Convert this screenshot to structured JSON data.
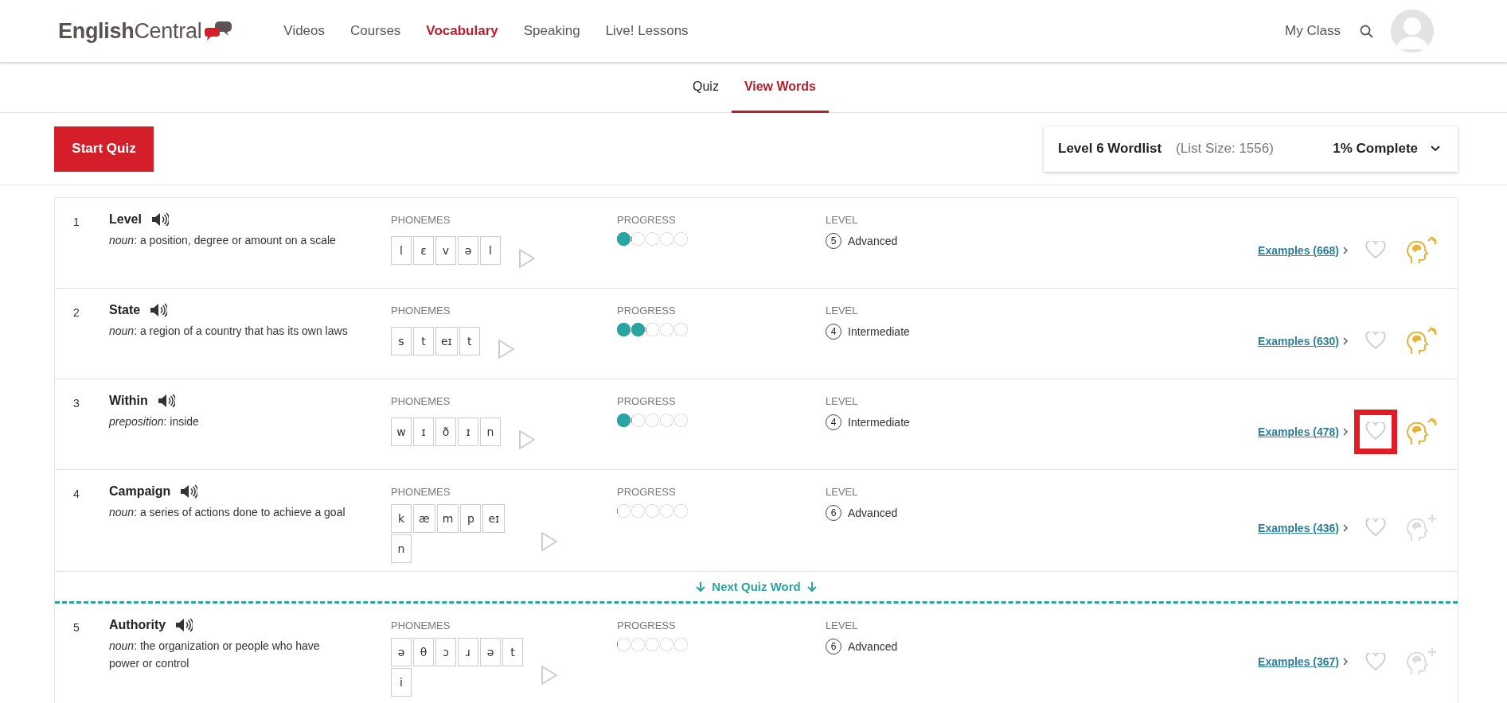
{
  "header": {
    "logo": "**English**Central",
    "nav": [
      {
        "label": "Videos",
        "selected": false
      },
      {
        "label": "Courses",
        "selected": false
      },
      {
        "label": "Vocabulary",
        "selected": true
      },
      {
        "label": "Speaking",
        "selected": false
      },
      {
        "label": "Live! Lessons",
        "selected": false
      }
    ],
    "my_class": "My Class"
  },
  "subtabs": [
    {
      "label": "Quiz",
      "selected": false
    },
    {
      "label": "View Words",
      "selected": true
    }
  ],
  "start_quiz": "Start Quiz",
  "wordlist": {
    "title": "Level 6 Wordlist",
    "size": "(List Size: 1556)",
    "complete": "1% Complete"
  },
  "list": [
    {
      "kind": "word",
      "number": "1",
      "word": "Level",
      "definition": "*noun*: a position, degree or amount on a scale",
      "phonemes_label": "PHONEMES",
      "phonemes": [
        "l",
        "ɛ",
        "v",
        "ə",
        "l"
      ],
      "progress_label": "PROGRESS",
      "level": 0.2,
      "level_label": "LEVEL",
      "level_number": "5",
      "level_name": "Advanced",
      "examples": "Examples (668)",
      "favorite": false,
      "highlighted": false,
      "memory_icon": {
        "kind": "review"
      }
    },
    {
      "kind": "word",
      "number": "2",
      "word": "State",
      "definition": "*noun*: a region of a country that has its own laws",
      "phonemes_label": "PHONEMES",
      "phonemes": [
        "s",
        "t",
        "eɪ",
        "t"
      ],
      "progress_label": "PROGRESS",
      "level": 0.4,
      "level_label": "LEVEL",
      "level_number": "4",
      "level_name": "Intermediate",
      "examples": "Examples (630)",
      "favorite": false,
      "highlighted": false,
      "memory_icon": {
        "kind": "review"
      }
    },
    {
      "kind": "word",
      "number": "3",
      "word": "Within",
      "definition": "*preposition*: inside",
      "phonemes_label": "PHONEMES",
      "phonemes": [
        "w",
        "ɪ",
        "ð",
        "ɪ",
        "n"
      ],
      "progress_label": "PROGRESS",
      "level": 0.2,
      "level_label": "LEVEL",
      "level_number": "4",
      "level_name": "Intermediate",
      "examples": "Examples (478)",
      "favorite": false,
      "highlighted": true,
      "memory_icon": {
        "kind": "review"
      }
    },
    {
      "kind": "word",
      "number": "4",
      "word": "Campaign",
      "definition": "*noun*: a series of actions done to achieve a goal",
      "phonemes_label": "PHONEMES",
      "phonemes": [
        "k",
        "æ",
        "m",
        "p",
        "eɪ",
        "n"
      ],
      "progress_label": "PROGRESS",
      "level": 0,
      "level_label": "LEVEL",
      "level_number": "6",
      "level_name": "Advanced",
      "examples": "Examples (436)",
      "favorite": false,
      "highlighted": false,
      "memory_icon": {
        "kind": "add"
      }
    },
    {
      "kind": "next_quiz",
      "label": "Next Quiz Word"
    },
    {
      "kind": "word",
      "number": "5",
      "word": "Authority",
      "definition": "*noun*: the organization or people who have power or control",
      "phonemes_label": "PHONEMES",
      "phonemes": [
        "ə",
        "θ",
        "ɔ",
        "ɹ",
        "ə",
        "t",
        "i"
      ],
      "progress_label": "PROGRESS",
      "level": 0,
      "level_label": "LEVEL",
      "level_number": "6",
      "level_name": "Advanced",
      "examples": "Examples (367)",
      "favorite": false,
      "highlighted": false,
      "memory_icon": {
        "kind": "add"
      }
    }
  ]
}
